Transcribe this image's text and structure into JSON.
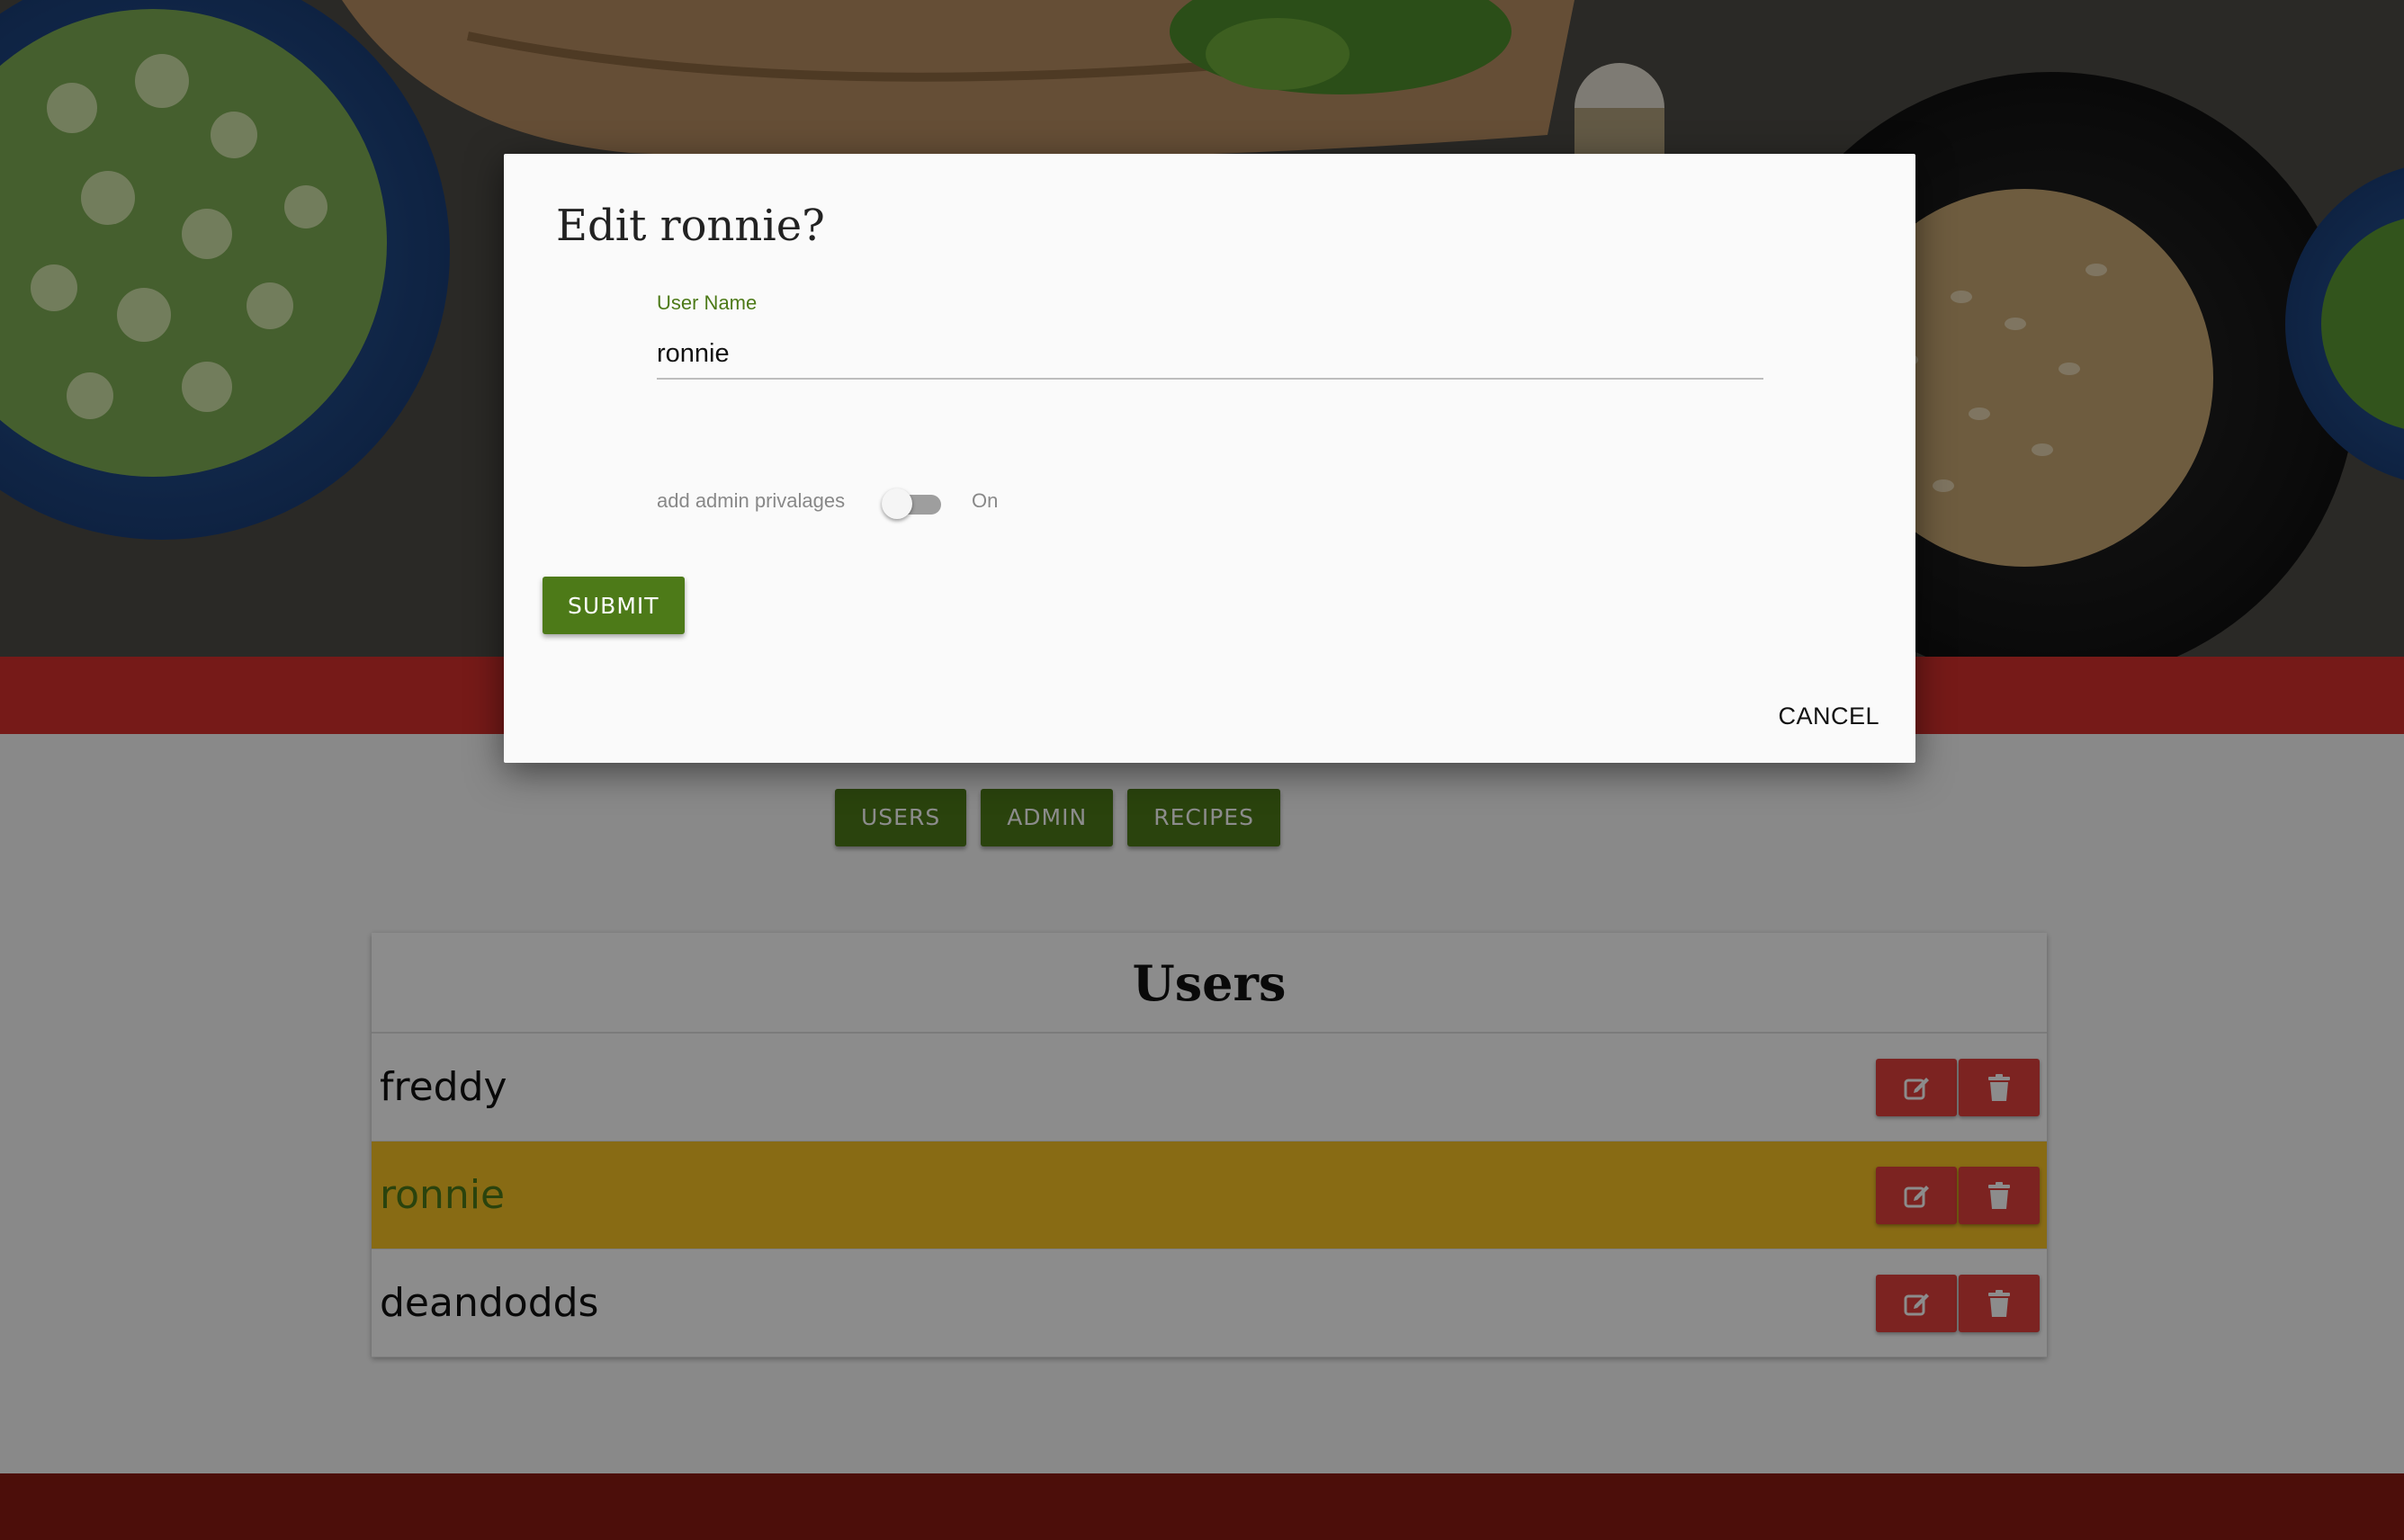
{
  "nav": {
    "users_label": "USERS",
    "admin_label": "ADMIN",
    "recipes_label": "RECIPES"
  },
  "users_card": {
    "title": "Users",
    "rows": [
      {
        "name": "freddy",
        "selected": false
      },
      {
        "name": "ronnie",
        "selected": true
      },
      {
        "name": "deandodds",
        "selected": false
      }
    ]
  },
  "dialog": {
    "title": "Edit ronnie?",
    "username_label": "User Name",
    "username_value": "ronnie",
    "admin_switch_label": "add admin privalages",
    "admin_switch_state_label": "On",
    "admin_switch_checked": false,
    "submit_label": "SUBMIT",
    "cancel_label": "CANCEL"
  },
  "colors": {
    "accent_green": "#4d7a18",
    "header_red": "#d7312c",
    "footer_red": "#8b1a12",
    "selected_row": "#f7c326",
    "action_red": "#e2413c"
  },
  "icons": {
    "edit": "edit-icon",
    "delete": "trash-icon"
  }
}
